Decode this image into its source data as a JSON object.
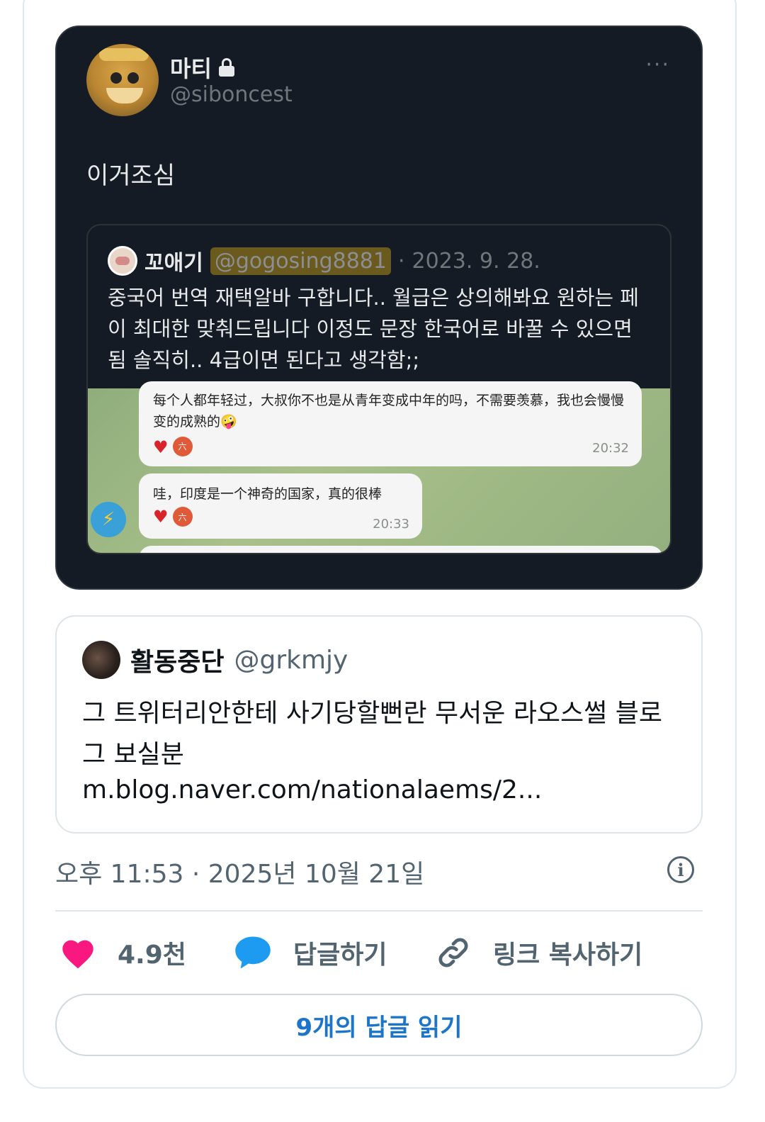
{
  "embedded_tweet": {
    "author_name": "마티",
    "author_handle": "@siboncest",
    "more_label": "···",
    "text": "이거조심",
    "quoted": {
      "author_name": "꼬애기",
      "author_handle": "@gogosing8881",
      "separator": "·",
      "date": "2023. 9. 28.",
      "body": "중국어 번역 재택알바 구합니다.. 월급은 상의해봐요 원하는 페이 최대한 맞춰드립니다 이정도 문장 한국어로 바꿀 수 있으면 됨 솔직히.. 4급이면 된다고 생각함;;",
      "chat": {
        "message1": "每个人都年轻过，大叔你不也是从青年变成中年的吗，不需要羡慕，我也会慢慢变的成熟的🤪",
        "time1": "20:32",
        "message2": "哇，印度是一个神奇的国家，真的很棒",
        "time2": "20:33",
        "badge": "六"
      }
    }
  },
  "link_card": {
    "author_name": "활동중단",
    "author_handle": "@grkmjy",
    "title": "그 트위터리안한테 사기당할뻔란 무서운 라오스썰 블로그 보실분",
    "url": "m.blog.naver.com/nationalaems/2..."
  },
  "meta": {
    "timestamp": "오후 11:53 · 2025년 10월 21일"
  },
  "actions": {
    "like_count": "4.9천",
    "reply_label": "답글하기",
    "copy_label": "링크 복사하기"
  },
  "read_replies_label": "9개의 답글 읽기",
  "colors": {
    "like": "#f91880",
    "reply": "#1d9bf0",
    "button_text": "#1d75c9"
  },
  "icons": [
    "lock-icon",
    "more-icon",
    "info-icon",
    "heart-icon",
    "reply-bubble-icon",
    "link-icon"
  ]
}
